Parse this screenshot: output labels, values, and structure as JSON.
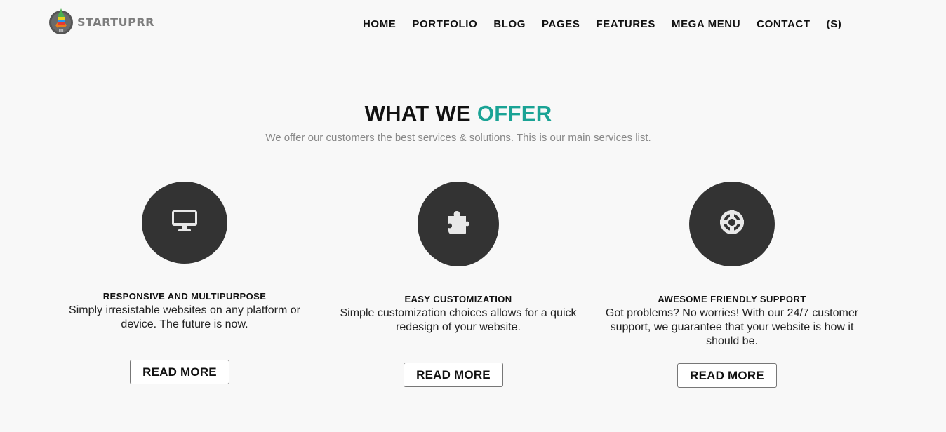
{
  "brand": {
    "name": "STARTUPRR",
    "colors": {
      "accent": "#1aa395",
      "logo_green": "#4caf50",
      "logo_orange": "#e87c1e"
    }
  },
  "nav": {
    "items": [
      {
        "label": "HOME"
      },
      {
        "label": "PORTFOLIO"
      },
      {
        "label": "BLOG"
      },
      {
        "label": "PAGES"
      },
      {
        "label": "FEATURES"
      },
      {
        "label": "MEGA MENU"
      },
      {
        "label": "CONTACT"
      },
      {
        "label": "(S)"
      }
    ]
  },
  "section": {
    "title_main": "WHAT WE",
    "title_accent": "OFFER",
    "subtitle": "We offer our customers the best services & solutions. This is our main services list."
  },
  "services": [
    {
      "icon": "monitor-icon",
      "title": "RESPONSIVE AND MULTIPURPOSE",
      "description": "Simply irresistable websites on any platform or device. The future is now.",
      "button_label": "READ MORE"
    },
    {
      "icon": "puzzle-icon",
      "title": "EASY CUSTOMIZATION",
      "description": "Simple customization choices allows for a quick redesign of your website.",
      "button_label": "READ MORE"
    },
    {
      "icon": "lifebuoy-icon",
      "title": "AWESOME FRIENDLY SUPPORT",
      "description": "Got problems? No worries! With our 24/7 customer support, we guarantee that your website is how it should be.",
      "button_label": "READ MORE"
    }
  ]
}
